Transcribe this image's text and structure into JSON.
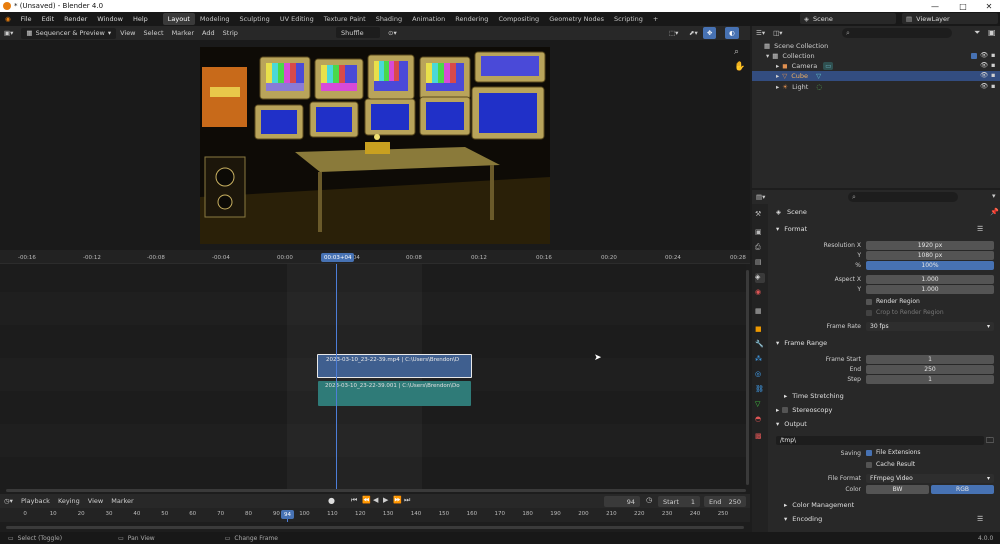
{
  "window": {
    "title": "* (Unsaved) - Blender 4.0",
    "controls": [
      "—",
      "□",
      "✕"
    ]
  },
  "menus": [
    "File",
    "Edit",
    "Render",
    "Window",
    "Help"
  ],
  "workspaces": [
    "Layout",
    "Modeling",
    "Sculpting",
    "UV Editing",
    "Texture Paint",
    "Shading",
    "Animation",
    "Rendering",
    "Compositing",
    "Geometry Nodes",
    "Scripting"
  ],
  "active_workspace": "Layout",
  "scene": {
    "label": "Scene",
    "view_layer": "ViewLayer"
  },
  "sequencer_header": {
    "editor": "Sequencer & Preview",
    "menus": [
      "View",
      "Select",
      "Marker",
      "Add",
      "Strip"
    ],
    "pivot": "Shuffle"
  },
  "ruler_ticks": [
    "-00:16",
    "-00:12",
    "-00:08",
    "-00:04",
    "00:00",
    "00:04",
    "00:08",
    "00:12",
    "00:16",
    "00:20",
    "00:24",
    "00:28"
  ],
  "playhead_label": "00:03+04",
  "strips": {
    "movie": "2023-03-10_23-22-39.mp4 | C:\\Users\\Brendon\\D",
    "sound": "2023-03-10_23-22-39.001 | C:\\Users\\Brendon\\Do"
  },
  "timeline": {
    "menus": [
      "Playback",
      "Keying",
      "View",
      "Marker"
    ],
    "current_frame": "94",
    "start_label": "Start",
    "start": "1",
    "end_label": "End",
    "end": "250",
    "ticks": [
      "0",
      "10",
      "20",
      "30",
      "40",
      "50",
      "60",
      "70",
      "80",
      "90",
      "100",
      "110",
      "120",
      "130",
      "140",
      "150",
      "160",
      "170",
      "180",
      "190",
      "200",
      "210",
      "220",
      "230",
      "240",
      "250"
    ],
    "frame_badge": "94"
  },
  "status": {
    "select": "Select (Toggle)",
    "pan": "Pan View",
    "change": "Change Frame",
    "version": "4.0.0"
  },
  "outliner": {
    "root": "Scene Collection",
    "collection": "Collection",
    "items": [
      {
        "name": "Camera"
      },
      {
        "name": "Cube"
      },
      {
        "name": "Light"
      }
    ]
  },
  "properties": {
    "context": "Scene",
    "format": {
      "title": "Format",
      "res_x_label": "Resolution X",
      "res_x": "1920 px",
      "res_y_label": "Y",
      "res_y": "1080 px",
      "pct_label": "%",
      "pct": "100%",
      "aspect_x_label": "Aspect X",
      "aspect_x": "1.000",
      "aspect_y_label": "Y",
      "aspect_y": "1.000",
      "render_region": "Render Region",
      "crop": "Crop to Render Region",
      "fps_label": "Frame Rate",
      "fps": "30 fps"
    },
    "frame_range": {
      "title": "Frame Range",
      "start_label": "Frame Start",
      "start": "1",
      "end_label": "End",
      "end": "250",
      "step_label": "Step",
      "step": "1"
    },
    "time_stretching": "Time Stretching",
    "stereoscopy": "Stereoscopy",
    "output": {
      "title": "Output",
      "path": "/tmp\\",
      "saving_label": "Saving",
      "file_ext": "File Extensions",
      "cache": "Cache Result",
      "format_label": "File Format",
      "format": "FFmpeg Video",
      "color_label": "Color",
      "bw": "BW",
      "rgb": "RGB"
    },
    "color_management": "Color Management",
    "encoding": "Encoding"
  },
  "colors": {
    "accent": "#4772b3",
    "movie_strip": "#3f5f8f",
    "sound_strip": "#2f7b78",
    "playhead": "#4d7ed8"
  }
}
